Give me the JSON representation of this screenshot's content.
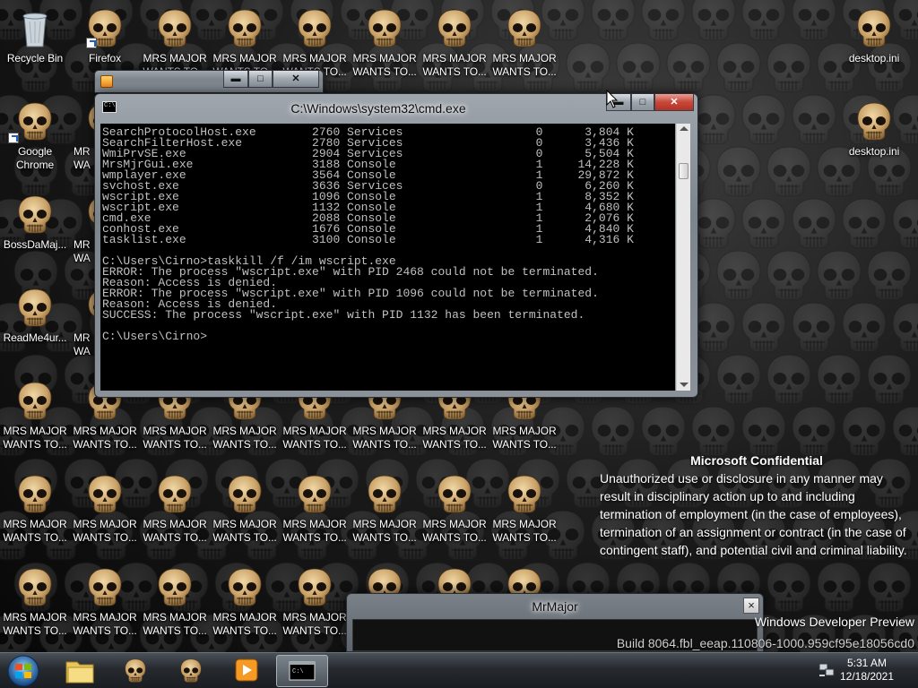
{
  "desktop": {
    "icons_left": [
      {
        "label": "Recycle Bin",
        "type": "recycle-bin"
      },
      {
        "label": "Google\nChrome",
        "type": "chrome"
      },
      {
        "label": "BossDaMaj...",
        "type": "skull"
      },
      {
        "label": "ReadMe4ur...",
        "type": "skull"
      }
    ],
    "icons_top": [
      {
        "label": "Firefox",
        "type": "skull"
      },
      {
        "label": "MRS MAJOR\nWANTS TO...",
        "type": "skull"
      },
      {
        "label": "MRS MAJOR\nWANTS TO...",
        "type": "skull"
      },
      {
        "label": "MRS MAJOR\nWANTS TO...",
        "type": "skull"
      },
      {
        "label": "MRS MAJOR\nWANTS TO...",
        "type": "skull"
      },
      {
        "label": "MRS MAJOR\nWANTS TO...",
        "type": "skull"
      },
      {
        "label": "MRS MAJOR\nWANTS TO...",
        "type": "skull"
      }
    ],
    "icons_right": [
      {
        "label": "desktop.ini",
        "type": "skull"
      },
      {
        "label": "desktop.ini",
        "type": "skull"
      }
    ],
    "grid_label": "MRS MAJOR\nWANTS TO...",
    "partial_label_col2": [
      "MR\nWA",
      "MR\nWA",
      "MR\nWA"
    ]
  },
  "cmd_window": {
    "title": "C:\\Windows\\system32\\cmd.exe",
    "lines": [
      "SearchProtocolHost.exe        2760 Services                   0      3,804 K",
      "SearchFilterHost.exe          2780 Services                   0      3,436 K",
      "WmiPrvSE.exe                  2904 Services                   0      5,504 K",
      "MrsMjrGui.exe                 3188 Console                    1     14,228 K",
      "wmplayer.exe                  3564 Console                    1     29,872 K",
      "svchost.exe                   3636 Services                   0      6,260 K",
      "wscript.exe                   1096 Console                    1      8,352 K",
      "wscript.exe                   1132 Console                    1      4,680 K",
      "cmd.exe                       2088 Console                    1      2,076 K",
      "conhost.exe                   1676 Console                    1      4,840 K",
      "tasklist.exe                  3100 Console                    1      4,316 K",
      "",
      "C:\\Users\\Cirno>taskkill /f /im wscript.exe",
      "ERROR: The process \"wscript.exe\" with PID 2468 could not be terminated.",
      "Reason: Access is denied.",
      "ERROR: The process \"wscript.exe\" with PID 1096 could not be terminated.",
      "Reason: Access is denied.",
      "SUCCESS: The process \"wscript.exe\" with PID 1132 has been terminated.",
      "",
      "C:\\Users\\Cirno>"
    ]
  },
  "watermark": {
    "heading": "Microsoft Confidential",
    "body": "Unauthorized use or disclosure in any manner may result in disciplinary action up to and including termination of employment (in the case of employees), termination of an assignment or contract (in the case of contingent staff), and potential civil and criminal liability.",
    "build_line1": "Windows Developer Preview",
    "build_line2": "Build 8064.fbl_eeap.110806-1000.959cf95e18056cd0"
  },
  "mrmajor_window": {
    "title": "MrMajor",
    "close": "×"
  },
  "taskbar": {
    "items": [
      "start-orb",
      "explorer",
      "skull-app",
      "skull-app",
      "media-player",
      "cmd"
    ],
    "time": "5:31 AM",
    "date": "12/18/2021"
  },
  "window_buttons": {
    "minimize": "▬",
    "maximize": "□",
    "close": "✕"
  }
}
